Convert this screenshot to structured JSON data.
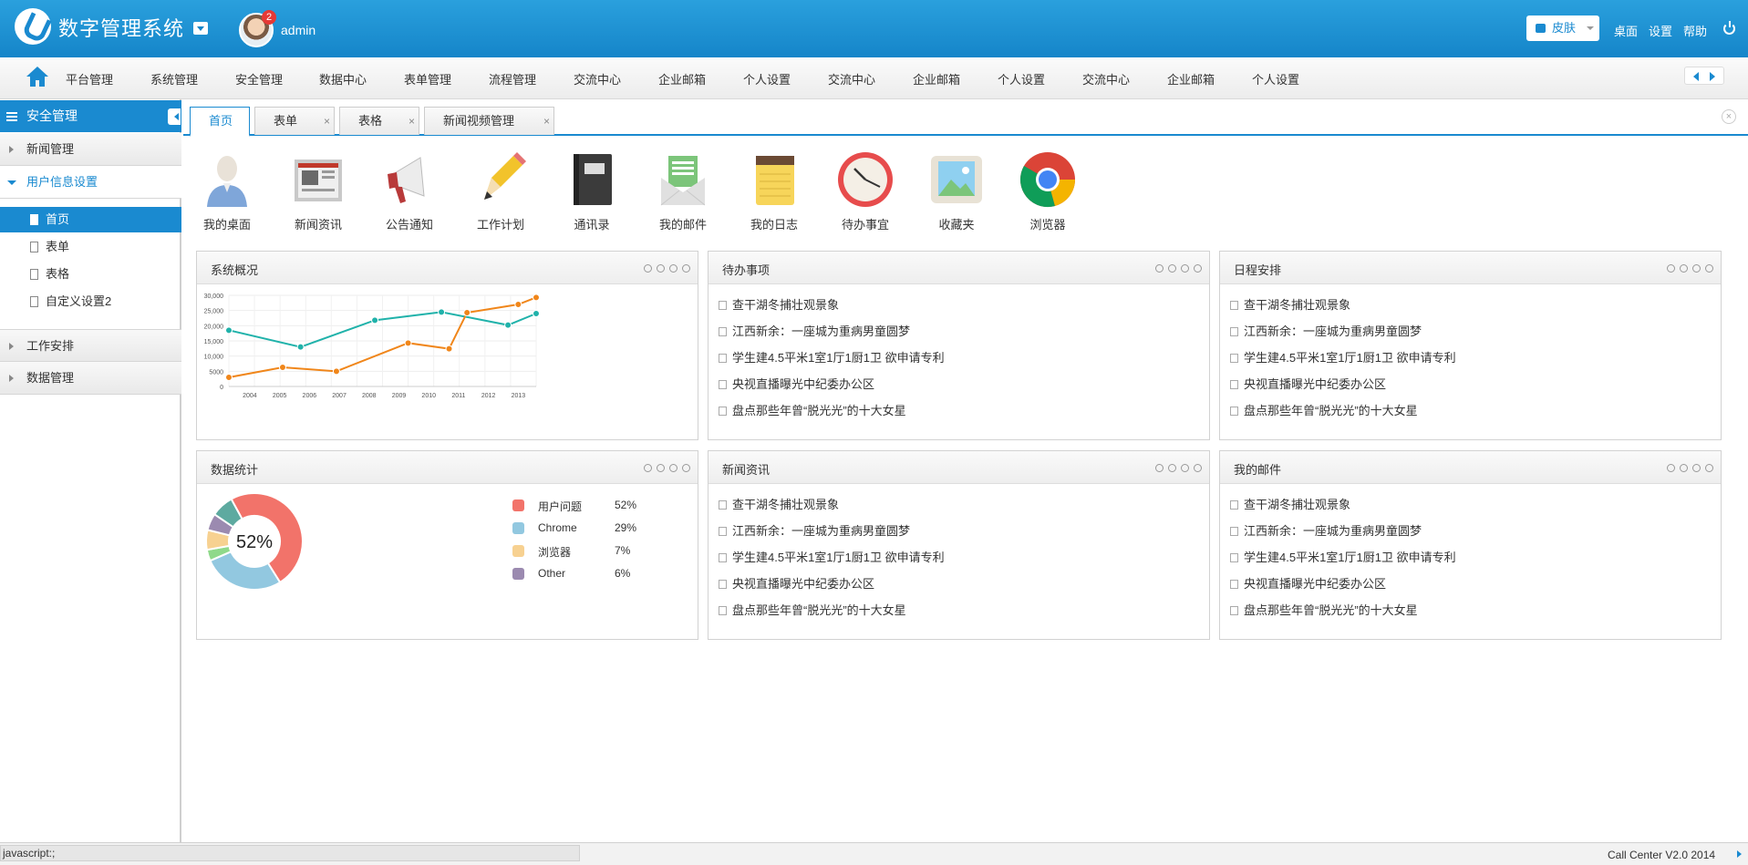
{
  "header": {
    "app_title": "数字管理系统",
    "username": "admin",
    "notification_count": "2",
    "skin_label": "皮肤",
    "links": [
      "桌面",
      "设置",
      "帮助"
    ]
  },
  "topnav": {
    "items": [
      "平台管理",
      "系统管理",
      "安全管理",
      "数据中心",
      "表单管理",
      "流程管理",
      "交流中心",
      "企业邮箱",
      "个人设置",
      "交流中心",
      "企业邮箱",
      "个人设置",
      "交流中心",
      "企业邮箱",
      "个人设置"
    ]
  },
  "sidebar": {
    "title": "安全管理",
    "groups": [
      "新闻管理",
      "用户信息设置",
      "工作安排",
      "数据管理"
    ],
    "items": [
      "首页",
      "表单",
      "表格",
      "自定义设置2"
    ]
  },
  "tabs": [
    {
      "label": "首页",
      "closable": false
    },
    {
      "label": "表单",
      "closable": true
    },
    {
      "label": "表格",
      "closable": true
    },
    {
      "label": "新闻视频管理",
      "closable": true
    }
  ],
  "shortcuts": [
    {
      "label": "我的桌面",
      "icon": "user-desktop-icon"
    },
    {
      "label": "新闻资讯",
      "icon": "newspaper-icon"
    },
    {
      "label": "公告通知",
      "icon": "megaphone-icon"
    },
    {
      "label": "工作计划",
      "icon": "pencil-icon"
    },
    {
      "label": "通讯录",
      "icon": "address-book-icon"
    },
    {
      "label": "我的邮件",
      "icon": "mail-icon"
    },
    {
      "label": "我的日志",
      "icon": "notepad-icon"
    },
    {
      "label": "待办事宜",
      "icon": "clock-icon"
    },
    {
      "label": "收藏夹",
      "icon": "picture-icon"
    },
    {
      "label": "浏览器",
      "icon": "chrome-icon"
    }
  ],
  "panels": {
    "overview_title": "系统概况",
    "todo_title": "待办事项",
    "schedule_title": "日程安排",
    "stats_title": "数据统计",
    "news_title": "新闻资讯",
    "mail_title": "我的邮件",
    "news_items": [
      "查干湖冬捕壮观景象",
      "江西新余：一座城为重病男童圆梦",
      "学生建4.5平米1室1厅1厨1卫 欲申请专利",
      "央视直播曝光中纪委办公区",
      "盘点那些年曾“脱光光”的十大女星"
    ]
  },
  "chart_data": [
    {
      "type": "line",
      "x": [
        "2004",
        "2005",
        "2006",
        "2007",
        "2008",
        "2009",
        "2010",
        "2011",
        "2012",
        "2013"
      ],
      "ylim": [
        0,
        30000
      ],
      "yticks": [
        "30,000",
        "25,000",
        "20,000",
        "15,000",
        "10,000",
        "5000",
        "0"
      ],
      "grid": true,
      "series": [
        {
          "color": "#20b2aa",
          "values": [
            18500,
            null,
            13000,
            null,
            21800,
            null,
            24500,
            null,
            20200,
            24000
          ],
          "x_index": [
            0,
            2.8,
            5.7,
            8.3,
            10.9,
            12
          ]
        },
        {
          "color": "#f0861a",
          "values": [
            3000,
            6300,
            5000,
            14300,
            12400,
            24300,
            27000,
            29300
          ],
          "x_index": [
            0,
            2.1,
            4.2,
            7,
            8.6,
            9.3,
            11.3,
            12
          ]
        }
      ]
    },
    {
      "type": "pie",
      "center_label": "52%",
      "slices": [
        {
          "label": "用户问题",
          "value": 52,
          "display": "52%",
          "color": "#f2736a"
        },
        {
          "label": "Chrome",
          "value": 29,
          "display": "29%",
          "color": "#92c8e0"
        },
        {
          "label": "浏览器",
          "value": 7,
          "display": "7%",
          "color": "#f7d191"
        },
        {
          "label": "Other",
          "value": 6,
          "display": "6%",
          "color": "#9b8ab0"
        }
      ]
    }
  ],
  "footer": {
    "status_url": "javascript:;",
    "copyright": "Call Center V2.0 2014"
  },
  "colors": {
    "brand": "#1a8ad0",
    "accent_orange": "#f0861a",
    "accent_teal": "#20b2aa"
  }
}
